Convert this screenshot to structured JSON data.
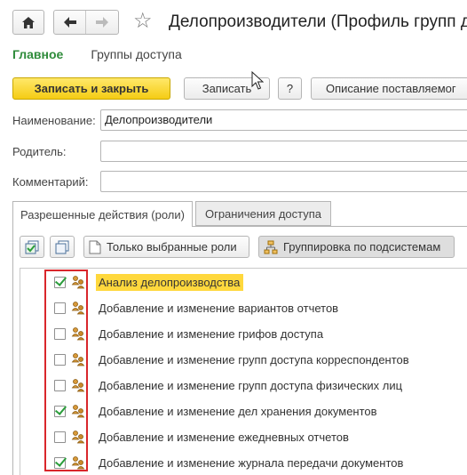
{
  "window": {
    "title": "Делопроизводители (Профиль групп до",
    "home_icon": "home-icon",
    "back_icon": "arrow-left-icon",
    "forward_icon": "arrow-right-icon",
    "favorite_icon": "star-icon"
  },
  "sections": [
    {
      "label": "Главное",
      "active": true
    },
    {
      "label": "Группы доступа",
      "active": false
    }
  ],
  "toolbar": {
    "save_close_label": "Записать и закрыть",
    "save_label": "Записать",
    "help_label": "?",
    "description_label": "Описание поставляемог"
  },
  "form": {
    "name_label": "Наименование:",
    "name_value": "Делопроизводители",
    "parent_label": "Родитель:",
    "parent_value": "",
    "comment_label": "Комментарий:",
    "comment_value": ""
  },
  "tabs": [
    {
      "label": "Разрешенные действия (роли)",
      "active": true
    },
    {
      "label": "Ограничения доступа",
      "active": false
    }
  ],
  "tab_toolbar": {
    "check_all_icon": "check-all-icon",
    "uncheck_all_icon": "uncheck-all-icon",
    "only_selected_label": "Только выбранные роли",
    "group_by_label": "Группировка по подсистемам"
  },
  "roles": [
    {
      "label": "Анализ делопроизводства",
      "checked": true,
      "highlighted": true
    },
    {
      "label": "Добавление и изменение вариантов отчетов",
      "checked": false,
      "highlighted": false
    },
    {
      "label": "Добавление и изменение грифов доступа",
      "checked": false,
      "highlighted": false
    },
    {
      "label": "Добавление и изменение групп доступа корреспондентов",
      "checked": false,
      "highlighted": false
    },
    {
      "label": "Добавление и изменение групп доступа физических лиц",
      "checked": false,
      "highlighted": false
    },
    {
      "label": "Добавление и изменение дел хранения документов",
      "checked": true,
      "highlighted": false
    },
    {
      "label": "Добавление и изменение ежедневных отчетов",
      "checked": false,
      "highlighted": false
    },
    {
      "label": "Добавление и изменение журнала передачи документов",
      "checked": true,
      "highlighted": false
    }
  ],
  "colors": {
    "accent_green": "#2e8b3a",
    "primary_button": "#f5cc14",
    "highlight": "#ffd83d",
    "annotation_red": "#d9262b"
  }
}
